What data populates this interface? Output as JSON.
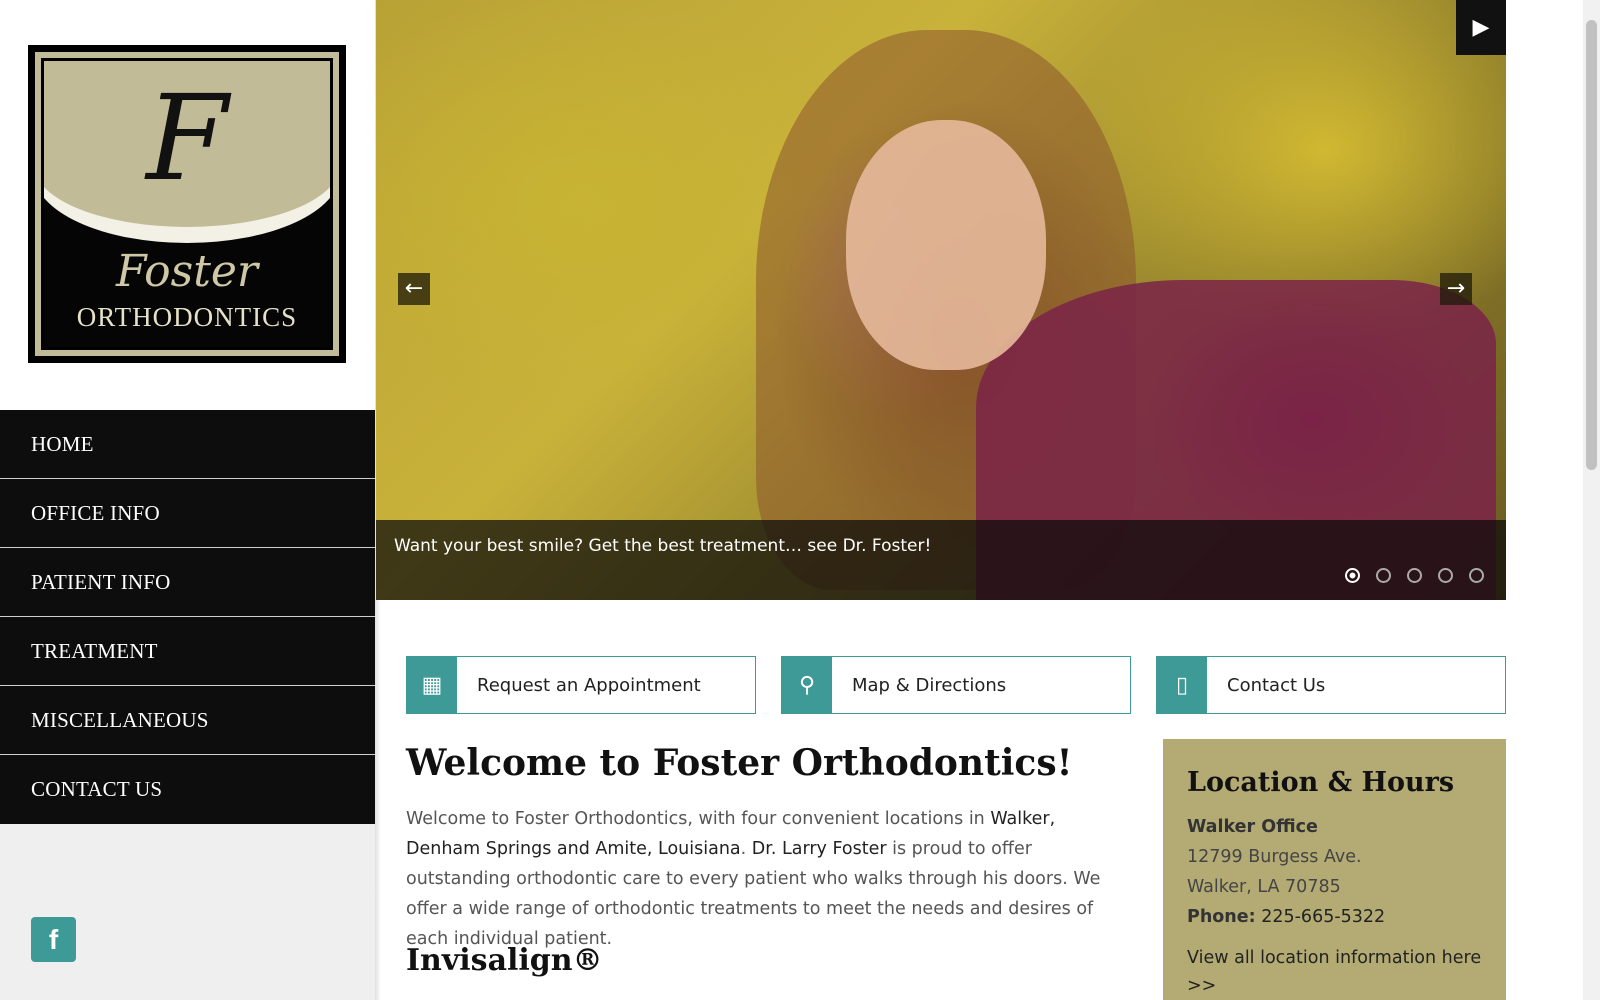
{
  "logo": {
    "letter": "F",
    "name": "Foster",
    "subtitle": "ORTHODONTICS"
  },
  "nav": {
    "items": [
      {
        "label": "HOME"
      },
      {
        "label": "OFFICE INFO"
      },
      {
        "label": "PATIENT INFO"
      },
      {
        "label": "TREATMENT"
      },
      {
        "label": "MISCELLANEOUS"
      },
      {
        "label": "CONTACT US"
      }
    ]
  },
  "social": {
    "facebook_glyph": "f"
  },
  "slider": {
    "caption": "Want your best smile? Get the best treatment… see Dr. Foster!",
    "prev_glyph": "←",
    "next_glyph": "→",
    "play_glyph": "▶",
    "slide_count": 5,
    "active_slide": 1
  },
  "cta": {
    "appointment": {
      "label": "Request an Appointment",
      "icon": "calendar-icon",
      "glyph": "▦"
    },
    "directions": {
      "label": "Map & Directions",
      "icon": "map-pin-icon",
      "glyph": "⚲"
    },
    "contact": {
      "label": "Contact Us",
      "icon": "phone-icon",
      "glyph": "▯"
    }
  },
  "welcome": {
    "title": "Welcome to Foster Orthodontics!",
    "p1": "Welcome to Foster Orthodontics, with four convenient locations in ",
    "locations": "Walker, Denham Springs and Amite, Louisiana",
    "p2": ". ",
    "doctor": "Dr. Larry Foster",
    "p3": " is proud to offer outstanding orthodontic care to every patient who walks through his doors. We offer a wide range of orthodontic treatments to meet the needs and desires of each individual patient.",
    "invisalign_title": "Invisalign®"
  },
  "hours": {
    "title": "Location & Hours",
    "office": "Walker Office",
    "street": "12799 Burgess Ave.",
    "city": "Walker, LA 70785",
    "phone_label": "Phone:",
    "phone": "225-665-5322",
    "link": "View all location information here >>"
  },
  "colors": {
    "teal": "#3d9a96",
    "olive": "#b4ab74",
    "nav_bg": "#0d0d0d"
  }
}
